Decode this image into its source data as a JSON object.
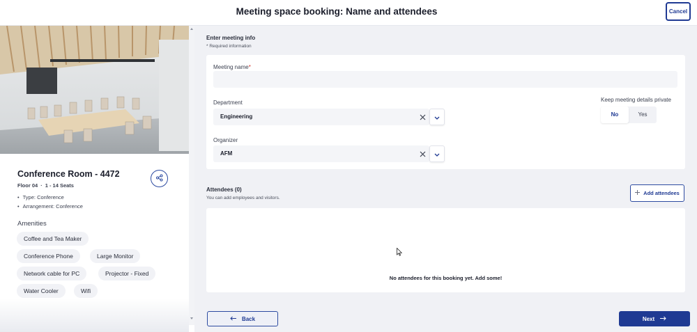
{
  "header": {
    "title": "Meeting space booking: Name and attendees",
    "cancel_label": "Cancel"
  },
  "room": {
    "name": "Conference Room - 4472",
    "floor": "Floor 04",
    "seats": "1 - 14 Seats",
    "attributes": [
      "Type: Conference",
      "Arrangement: Conference"
    ],
    "amenities_title": "Amenities",
    "amenities": [
      "Coffee and Tea Maker",
      "Conference Phone",
      "Large Monitor",
      "Network cable for PC",
      "Projector - Fixed",
      "Water Cooler",
      "Wifi"
    ]
  },
  "meeting_info": {
    "title": "Enter meeting info",
    "required_note": "* Required information",
    "name_label": "Meeting name",
    "name_required_mark": "*",
    "name_value": "",
    "department_label": "Department",
    "department_value": "Engineering",
    "organizer_label": "Organizer",
    "organizer_value": "AFM",
    "private_label": "Keep meeting details private",
    "private_options": [
      "No",
      "Yes"
    ],
    "private_selected": "No"
  },
  "attendees": {
    "title": "Attendees (0)",
    "subtitle": "You can add employees and visitors.",
    "add_label": "Add attendees",
    "empty_message": "No attendees for this booking yet. Add some!"
  },
  "footer": {
    "back_label": "Back",
    "next_label": "Next"
  },
  "colors": {
    "accent": "#1f3a93",
    "required": "#d0342c",
    "main_bg": "#f0f1f5"
  },
  "icons": [
    "share-icon",
    "clear-icon",
    "chevron-down-icon",
    "plus-icon",
    "arrow-left-icon",
    "arrow-right-icon",
    "mouse-cursor-icon"
  ]
}
